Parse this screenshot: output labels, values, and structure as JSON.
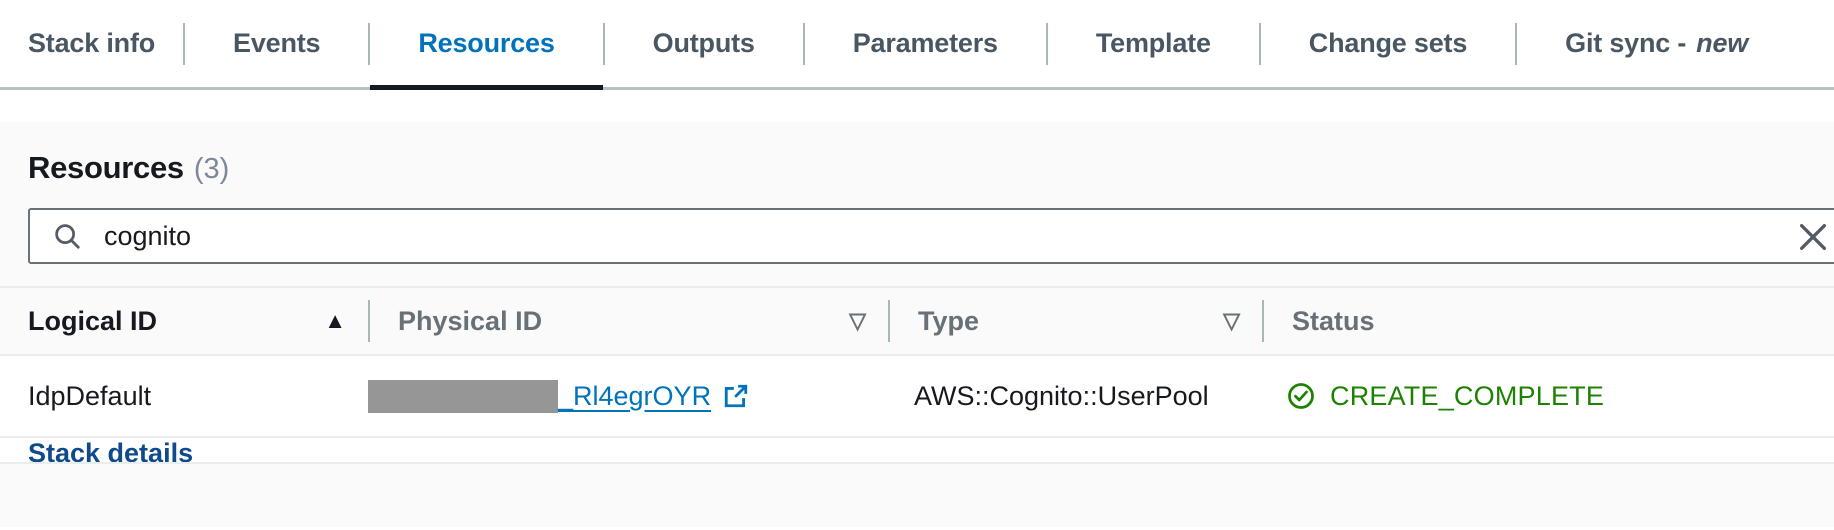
{
  "tabs": [
    {
      "label": "Stack info",
      "active": false
    },
    {
      "label": "Events",
      "active": false
    },
    {
      "label": "Resources",
      "active": true
    },
    {
      "label": "Outputs",
      "active": false
    },
    {
      "label": "Parameters",
      "active": false
    },
    {
      "label": "Template",
      "active": false
    },
    {
      "label": "Change sets",
      "active": false
    },
    {
      "label": "Git sync -",
      "suffix": "new",
      "active": false
    }
  ],
  "panel": {
    "title": "Resources",
    "count": "(3)"
  },
  "search": {
    "value": "cognito",
    "placeholder": "Search resources",
    "icon": "search-icon",
    "clear_icon": "close-icon"
  },
  "table": {
    "columns": [
      {
        "label": "Logical ID",
        "sort": "ascending",
        "sort_glyph": "▲"
      },
      {
        "label": "Physical ID",
        "sort": "none",
        "sort_glyph": "▽"
      },
      {
        "label": "Type",
        "sort": "none",
        "sort_glyph": "▽"
      },
      {
        "label": "Status",
        "sort": "none",
        "sort_glyph": ""
      }
    ],
    "rows": [
      {
        "logical_id": "IdpDefault",
        "physical_id_redacted": true,
        "physical_id_suffix": "_Rl4egrOYR",
        "physical_id_external_icon": "external-link-icon",
        "type": "AWS::Cognito::UserPool",
        "status": "CREATE_COMPLETE",
        "status_icon": "status-success-icon"
      },
      {
        "logical_id": "Stack details",
        "physical_id_redacted": false,
        "physical_id_suffix": "",
        "type": "",
        "status": ""
      }
    ]
  },
  "colors": {
    "link": "#0073bb",
    "active_tab": "#0073bb",
    "status_success": "#1d8102",
    "text_primary": "#16191f",
    "text_secondary": "#687078",
    "redaction": "#969696",
    "panel_bg": "#fafafa",
    "border": "#eaeded",
    "divider": "#aab7b8"
  }
}
